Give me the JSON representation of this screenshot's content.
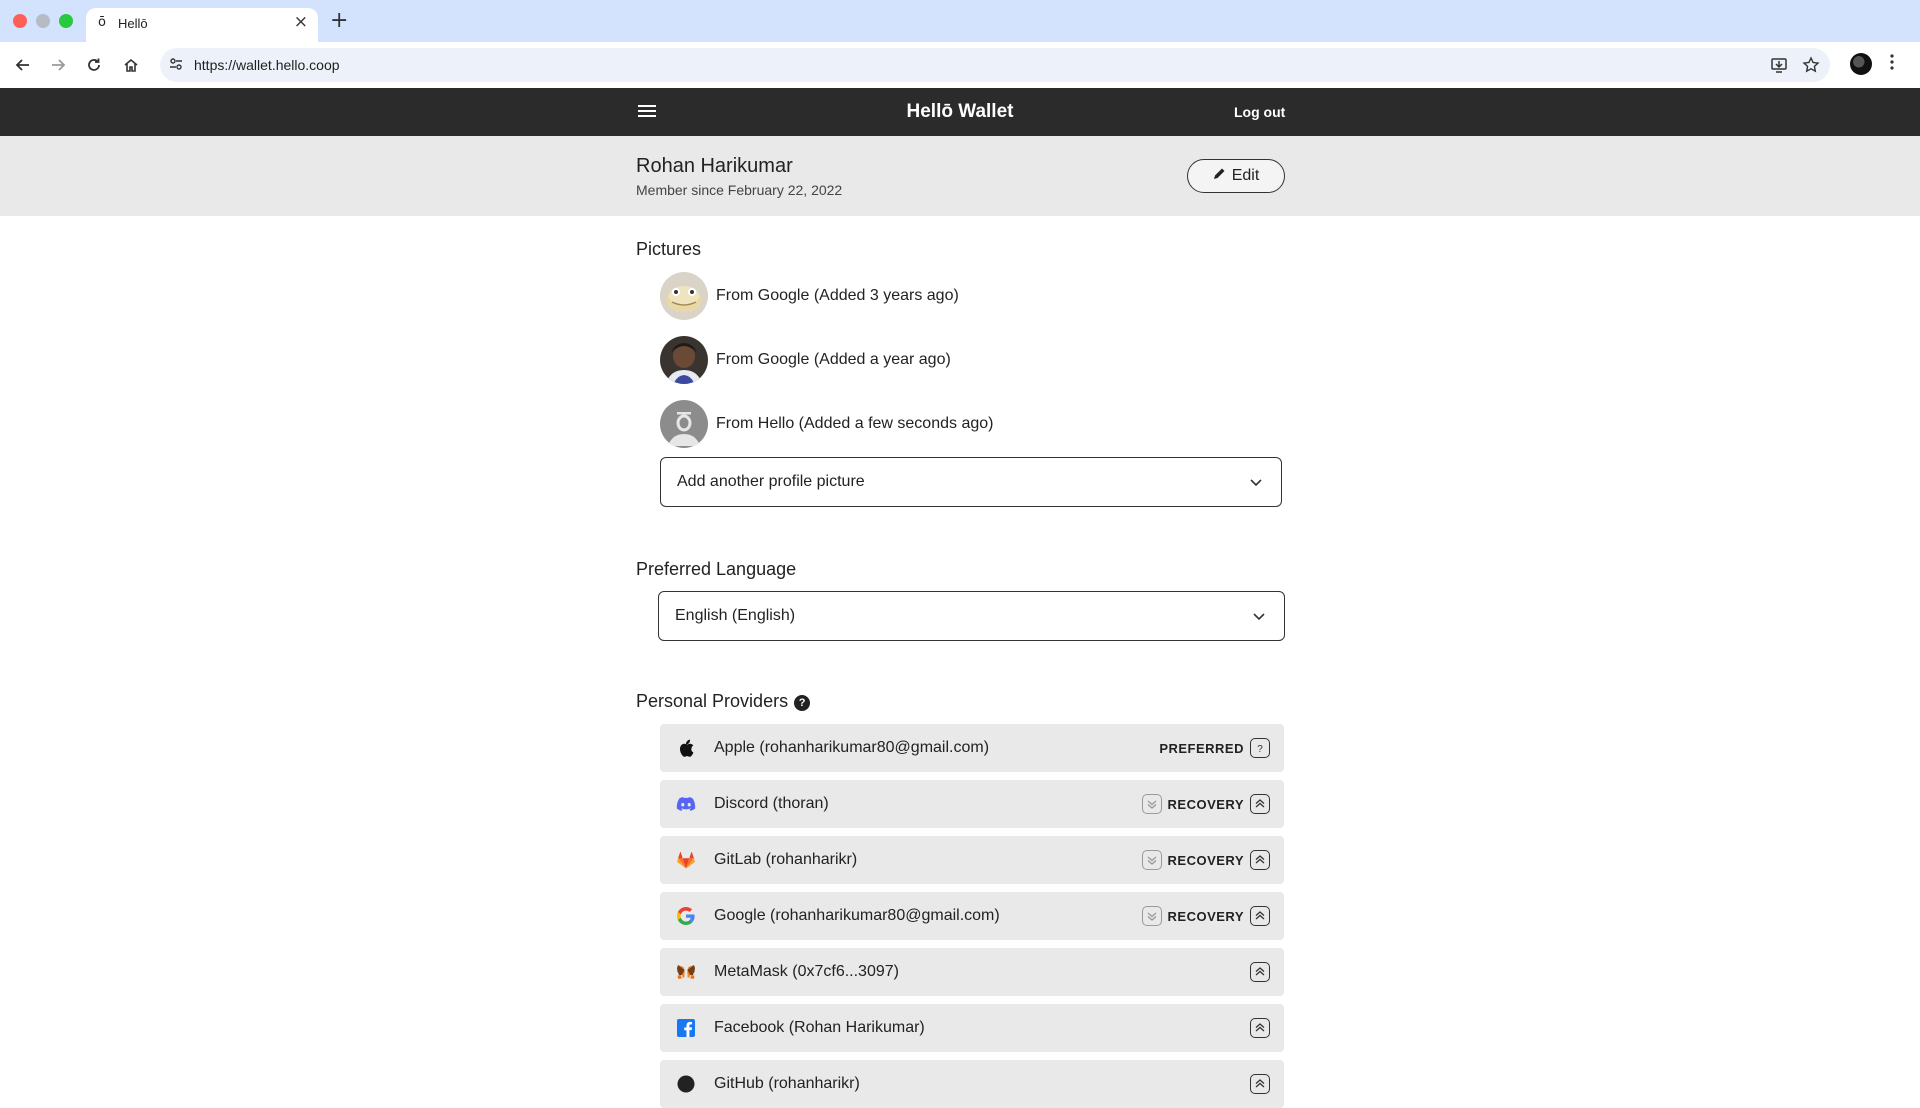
{
  "browser": {
    "tab_favicon": "ō",
    "tab_title": "Hellō",
    "url": "https://wallet.hello.coop"
  },
  "app": {
    "brand": "Hellō Wallet",
    "logout_label": "Log out"
  },
  "profile": {
    "name": "Rohan Harikumar",
    "member_since": "Member since February 22, 2022",
    "edit_label": "Edit"
  },
  "pictures": {
    "title": "Pictures",
    "items": [
      {
        "label": "From Google (Added 3 years ago)",
        "avatar": "gecko-avatar"
      },
      {
        "label": "From Google (Added a year ago)",
        "avatar": "person-avatar"
      },
      {
        "label": "From Hello (Added a few seconds ago)",
        "avatar": "hello-default-avatar"
      }
    ],
    "add_placeholder": "Add another profile picture"
  },
  "language": {
    "title": "Preferred Language",
    "selected": "English (English)"
  },
  "providers": {
    "title": "Personal Providers",
    "help_glyph": "?",
    "items": [
      {
        "label": "Apple (rohanharikumar80@gmail.com)",
        "icon": "apple-icon",
        "status": "PREFERRED"
      },
      {
        "label": "Discord (thoran)",
        "icon": "discord-icon",
        "status": "RECOVERY"
      },
      {
        "label": "GitLab (rohanharikr)",
        "icon": "gitlab-icon",
        "status": "RECOVERY"
      },
      {
        "label": "Google (rohanharikumar80@gmail.com)",
        "icon": "google-icon",
        "status": "RECOVERY"
      },
      {
        "label": "MetaMask (0x7cf6...3097)",
        "icon": "metamask-icon",
        "status": ""
      },
      {
        "label": "Facebook (Rohan Harikumar)",
        "icon": "facebook-icon",
        "status": ""
      },
      {
        "label": "GitHub (rohanharikr)",
        "icon": "github-icon",
        "status": ""
      }
    ]
  },
  "colors": {
    "appbar": "#2b2b2b",
    "profile_band": "#e9e9e9",
    "provider_row": "#e9e9e9",
    "discord": "#5865f2",
    "gitlab": "#e24329",
    "facebook": "#1877f2",
    "metamask": "#e2761b"
  }
}
